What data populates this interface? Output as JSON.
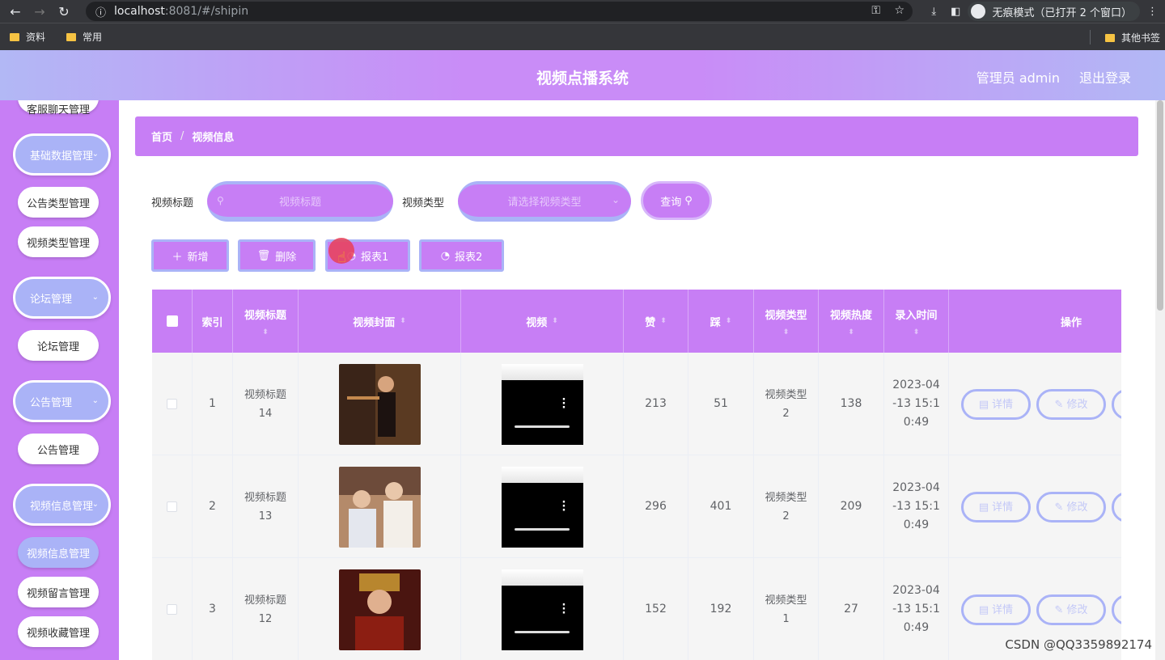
{
  "browser": {
    "url_host": "localhost",
    "url_path": ":8081/#/shipin",
    "incognito_label": "无痕模式（已打开 2 个窗口）",
    "bookmarks": [
      "资料",
      "常用"
    ],
    "other_bookmarks": "其他书签"
  },
  "header": {
    "title": "视频点播系统",
    "user": "管理员 admin",
    "logout": "退出登录"
  },
  "sidebar": {
    "partial_top": "客服聊天管理",
    "groups": [
      {
        "label": "基础数据管理",
        "items": [
          "公告类型管理",
          "视频类型管理"
        ]
      },
      {
        "label": "论坛管理",
        "items": [
          "论坛管理"
        ]
      },
      {
        "label": "公告管理",
        "items": [
          "公告管理"
        ]
      },
      {
        "label": "视频信息管理",
        "items": [
          "视频信息管理",
          "视频留言管理",
          "视频收藏管理"
        ]
      }
    ]
  },
  "breadcrumb": {
    "home": "首页",
    "current": "视频信息"
  },
  "search": {
    "title_label": "视频标题",
    "title_placeholder": "视频标题",
    "type_label": "视频类型",
    "type_placeholder": "请选择视频类型",
    "query_button": "查询"
  },
  "actions": {
    "add": "新增",
    "delete": "删除",
    "report1": "报表1",
    "report2": "报表2"
  },
  "table": {
    "columns": [
      "索引",
      "视频标题",
      "视频封面",
      "视频",
      "赞",
      "踩",
      "视频类型",
      "视频热度",
      "录入时间",
      "操作"
    ],
    "rows": [
      {
        "index": "1",
        "title": "视频标题14",
        "likes": "213",
        "dislikes": "51",
        "type": "视频类型2",
        "heat": "138",
        "time": "2023-04-13 15:10:49"
      },
      {
        "index": "2",
        "title": "视频标题13",
        "likes": "296",
        "dislikes": "401",
        "type": "视频类型2",
        "heat": "209",
        "time": "2023-04-13 15:10:49"
      },
      {
        "index": "3",
        "title": "视频标题12",
        "likes": "152",
        "dislikes": "192",
        "type": "视频类型1",
        "heat": "27",
        "time": "2023-04-13 15:10:49"
      }
    ],
    "op_detail": "详情",
    "op_edit": "修改"
  },
  "watermark": "CSDN @QQ3359892174"
}
